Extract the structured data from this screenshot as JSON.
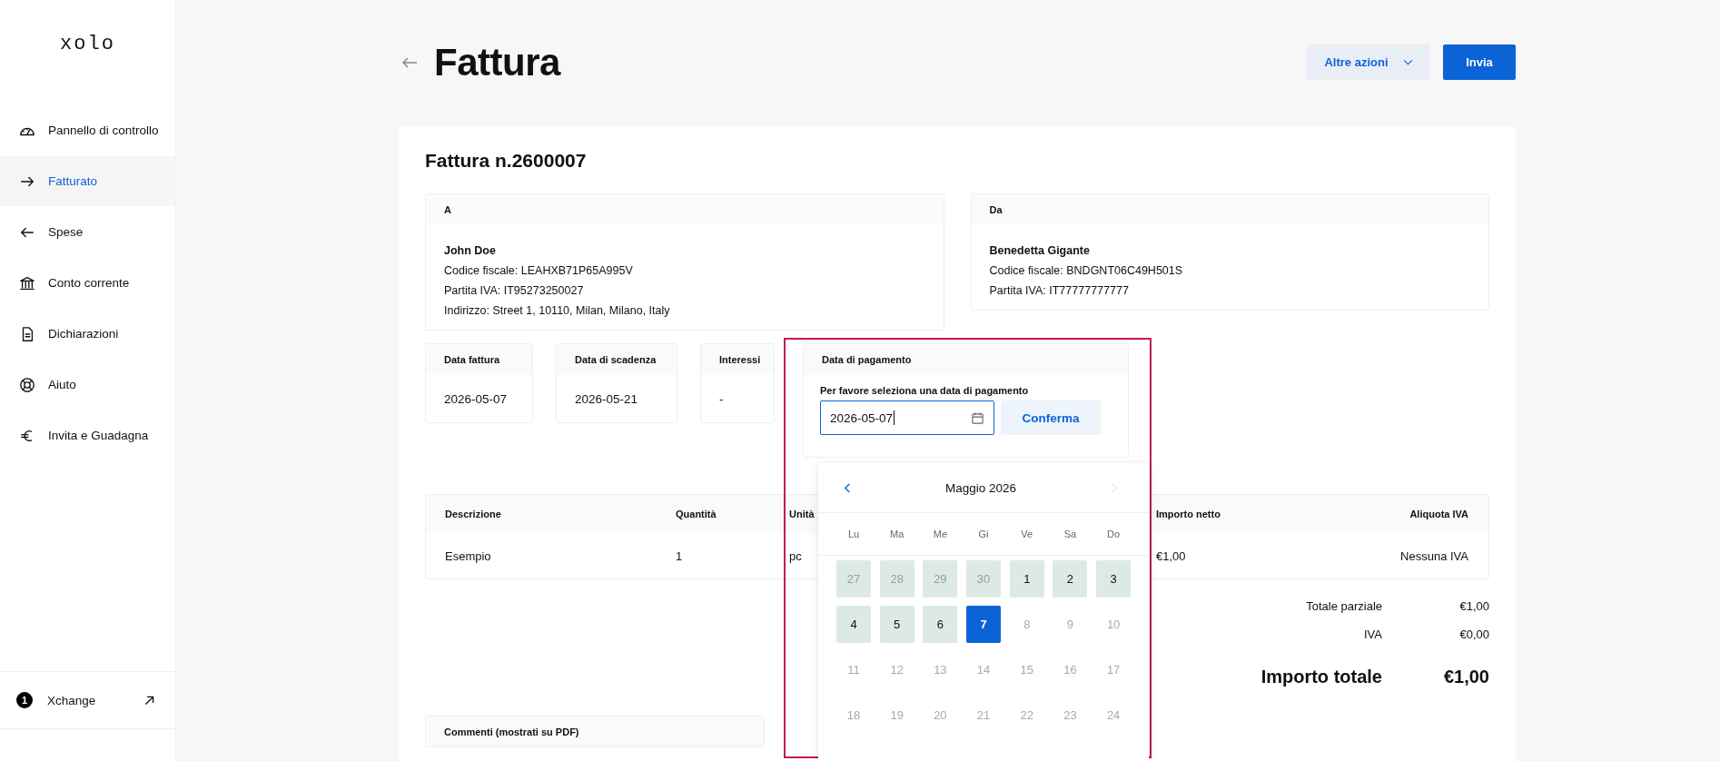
{
  "logo": "xolo",
  "sidebar": {
    "items": [
      {
        "label": "Pannello di controllo",
        "selected": false
      },
      {
        "label": "Fatturato",
        "selected": true
      },
      {
        "label": "Spese",
        "selected": false
      },
      {
        "label": "Conto corrente",
        "selected": false
      },
      {
        "label": "Dichiarazioni",
        "selected": false
      },
      {
        "label": "Aiuto",
        "selected": false
      },
      {
        "label": "Invita e Guadagna",
        "selected": false
      }
    ],
    "footer": {
      "badge": "1",
      "label": "Xchange"
    }
  },
  "header": {
    "title": "Fattura",
    "buttons": [
      {
        "label": "Altre azioni",
        "kind": "dropdown"
      },
      {
        "label": "Invia",
        "kind": "primary"
      }
    ]
  },
  "invoice": {
    "title": "Fattura n.2600007",
    "parties": [
      {
        "heading": "A",
        "name": "John Doe",
        "lines": [
          "Codice fiscale: LEAHXB71P65A995V",
          "Partita IVA: IT95273250027",
          "Indirizzo: Street 1, 10110, Milan, Milano, Italy"
        ]
      },
      {
        "heading": "Da",
        "name": "Benedetta Gigante",
        "lines": [
          "Codice fiscale: BNDGNT06C49H501S",
          "Partita IVA: IT77777777777"
        ]
      }
    ],
    "dates": [
      {
        "heading": "Data fattura",
        "value": "2026-05-07"
      },
      {
        "heading": "Data di scadenza",
        "value": "2026-05-21"
      },
      {
        "heading": "Interessi",
        "value": "-"
      }
    ],
    "payment": {
      "heading": "Data di pagamento",
      "label": "Per favore seleziona una data di pagamento",
      "value": "2026-05-07",
      "button": "Conferma"
    },
    "table": {
      "columns": [
        {
          "label": "Descrizione"
        },
        {
          "label": "Quantità"
        },
        {
          "label": "Unità"
        },
        {
          "label": "Importo netto"
        },
        {
          "label": "Aliquota IVA"
        }
      ],
      "rows": [
        [
          "Esempio",
          "1",
          "pc",
          "€1,00",
          "Nessuna IVA"
        ]
      ]
    },
    "totals": [
      {
        "label": "Totale parziale",
        "value": "€1,00",
        "kind": "normal"
      },
      {
        "label": "IVA",
        "value": "€0,00",
        "kind": "normal"
      },
      {
        "label": "Importo totale",
        "value": "€1,00",
        "kind": "grand"
      }
    ],
    "comments": {
      "heading": "Commenti (mostrati su PDF)"
    }
  },
  "calendar": {
    "month": "Maggio 2026",
    "weekdays": [
      "Lu",
      "Ma",
      "Me",
      "Gi",
      "Ve",
      "Sa",
      "Do"
    ],
    "days": [
      {
        "label": "27",
        "kind": "outside",
        "selected": false
      },
      {
        "label": "28",
        "kind": "outside",
        "selected": false
      },
      {
        "label": "29",
        "kind": "outside",
        "selected": false
      },
      {
        "label": "30",
        "kind": "outside",
        "selected": false
      },
      {
        "label": "1",
        "kind": "available",
        "selected": false
      },
      {
        "label": "2",
        "kind": "available",
        "selected": false
      },
      {
        "label": "3",
        "kind": "available",
        "selected": false
      },
      {
        "label": "4",
        "kind": "available",
        "selected": false
      },
      {
        "label": "5",
        "kind": "available",
        "selected": false
      },
      {
        "label": "6",
        "kind": "available",
        "selected": false
      },
      {
        "label": "7",
        "kind": "available",
        "selected": true
      },
      {
        "label": "8",
        "kind": "unavailable",
        "selected": false
      },
      {
        "label": "9",
        "kind": "unavailable",
        "selected": false
      },
      {
        "label": "10",
        "kind": "unavailable",
        "selected": false
      },
      {
        "label": "11",
        "kind": "unavailable",
        "selected": false
      },
      {
        "label": "12",
        "kind": "unavailable",
        "selected": false
      },
      {
        "label": "13",
        "kind": "unavailable",
        "selected": false
      },
      {
        "label": "14",
        "kind": "unavailable",
        "selected": false
      },
      {
        "label": "15",
        "kind": "unavailable",
        "selected": false
      },
      {
        "label": "16",
        "kind": "unavailable",
        "selected": false
      },
      {
        "label": "17",
        "kind": "unavailable",
        "selected": false
      },
      {
        "label": "18",
        "kind": "unavailable",
        "selected": false
      },
      {
        "label": "19",
        "kind": "unavailable",
        "selected": false
      },
      {
        "label": "20",
        "kind": "unavailable",
        "selected": false
      },
      {
        "label": "21",
        "kind": "unavailable",
        "selected": false
      },
      {
        "label": "22",
        "kind": "unavailable",
        "selected": false
      },
      {
        "label": "23",
        "kind": "unavailable",
        "selected": false
      },
      {
        "label": "24",
        "kind": "unavailable",
        "selected": false
      }
    ]
  }
}
